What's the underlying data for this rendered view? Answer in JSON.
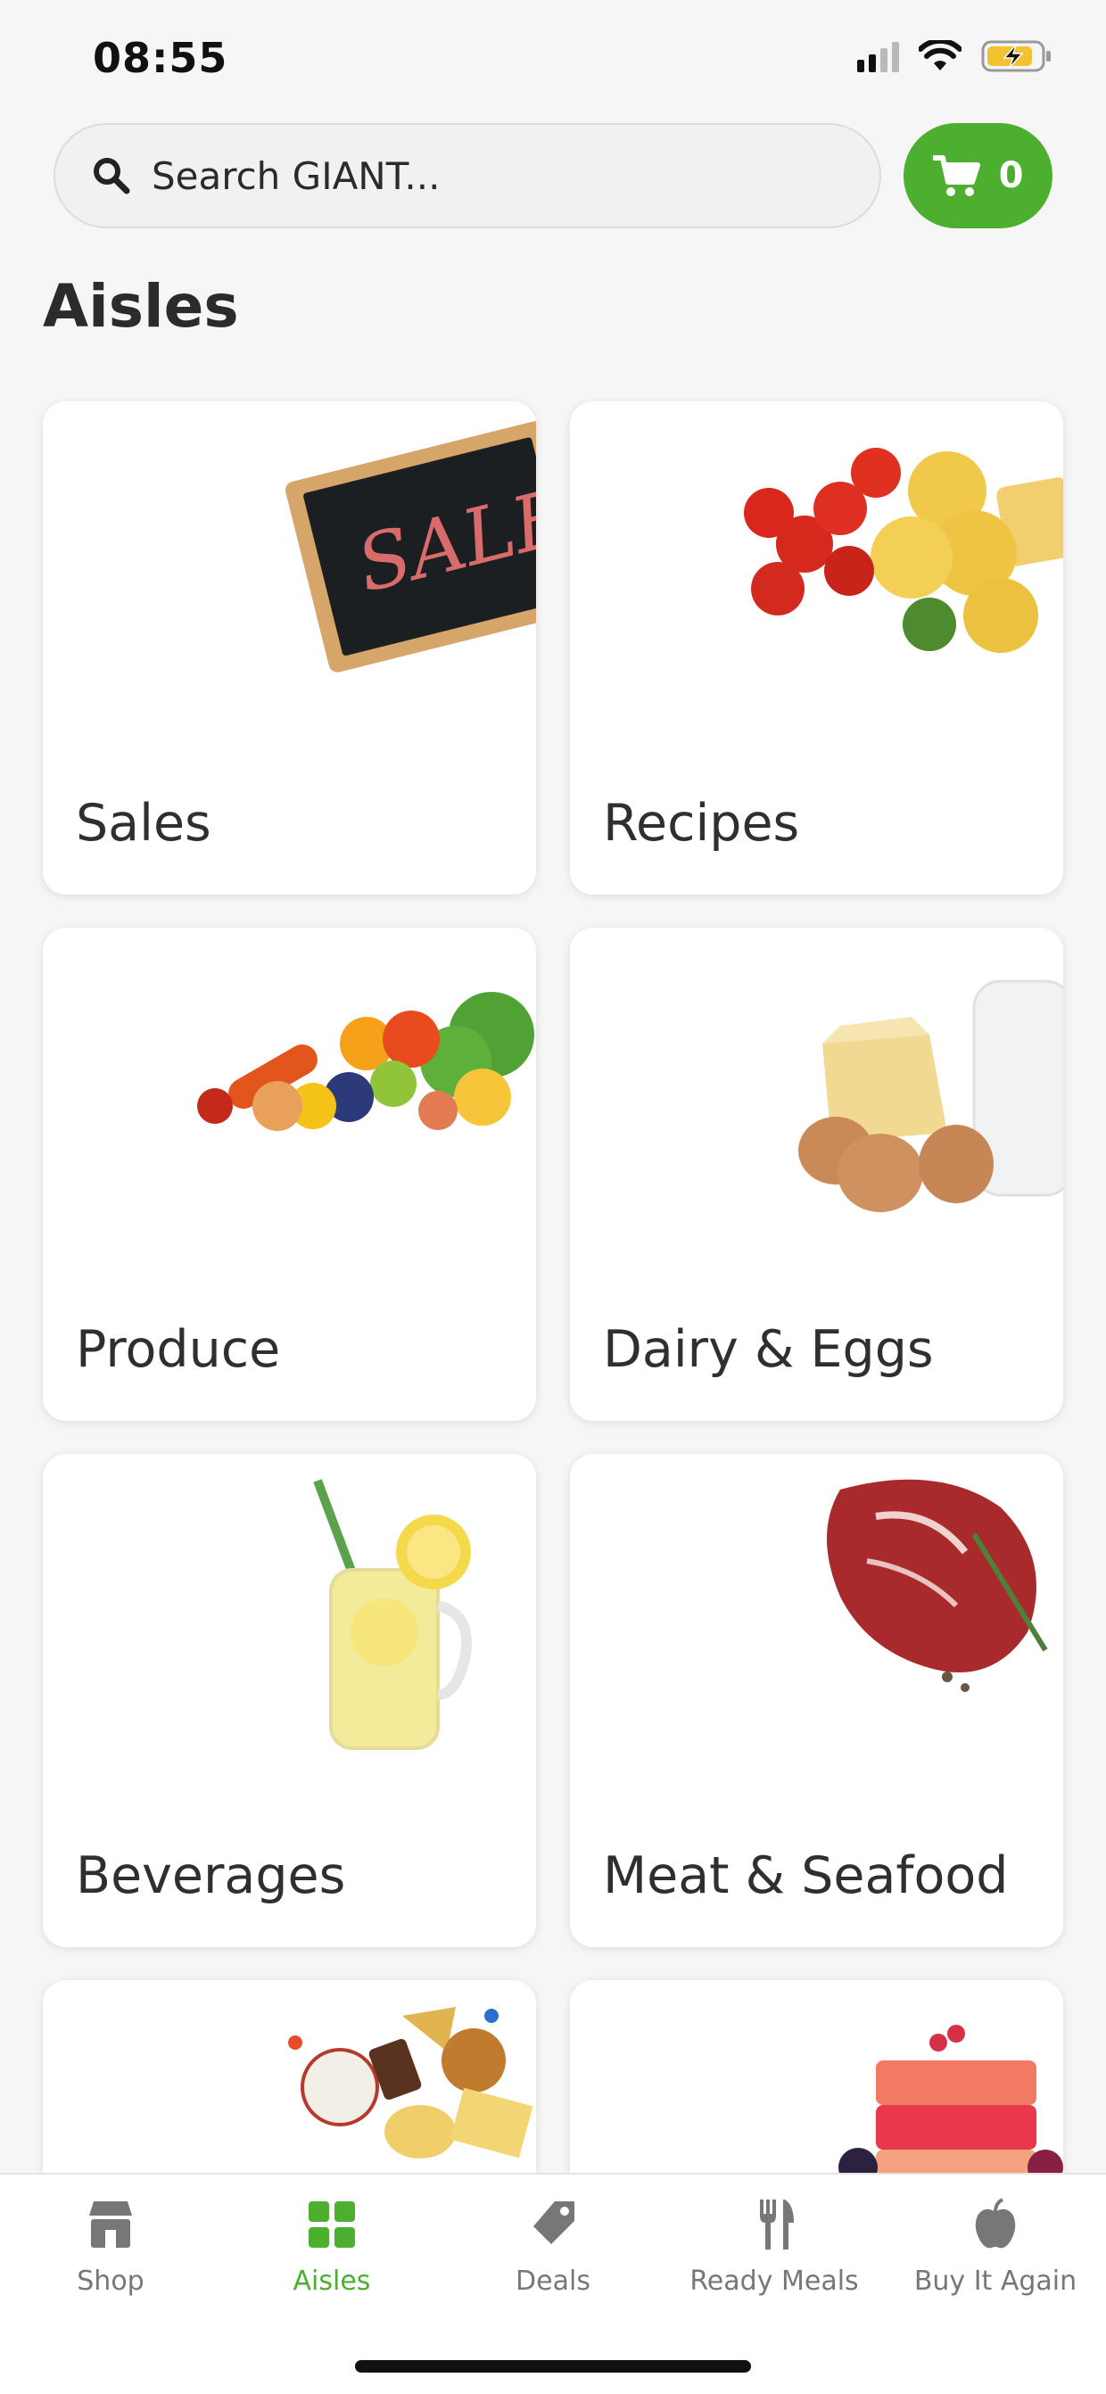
{
  "status": {
    "time": "08:55"
  },
  "search": {
    "placeholder": "Search GIANT..."
  },
  "cart": {
    "count": "0"
  },
  "page": {
    "title": "Aisles"
  },
  "aisles": [
    {
      "label": "Sales",
      "icon": "sale-chalkboard-image"
    },
    {
      "label": "Recipes",
      "icon": "pasta-tomato-image"
    },
    {
      "label": "Produce",
      "icon": "fruit-vegetable-image"
    },
    {
      "label": "Dairy & Eggs",
      "icon": "cheese-eggs-milk-image"
    },
    {
      "label": "Beverages",
      "icon": "lemonade-jar-image"
    },
    {
      "label": "Meat & Seafood",
      "icon": "steak-image"
    },
    {
      "label": "",
      "icon": "snacks-image"
    },
    {
      "label": "",
      "icon": "frozen-dessert-image"
    }
  ],
  "nav": {
    "items": [
      {
        "label": "Shop",
        "icon": "store-icon"
      },
      {
        "label": "Aisles",
        "icon": "grid-icon",
        "active": true
      },
      {
        "label": "Deals",
        "icon": "tag-icon"
      },
      {
        "label": "Ready Meals",
        "icon": "fork-knife-icon"
      },
      {
        "label": "Buy It Again",
        "icon": "apple-icon"
      }
    ]
  },
  "colors": {
    "accent": "#4caf2f",
    "text": "#2f2f2f",
    "muted": "#777777"
  }
}
